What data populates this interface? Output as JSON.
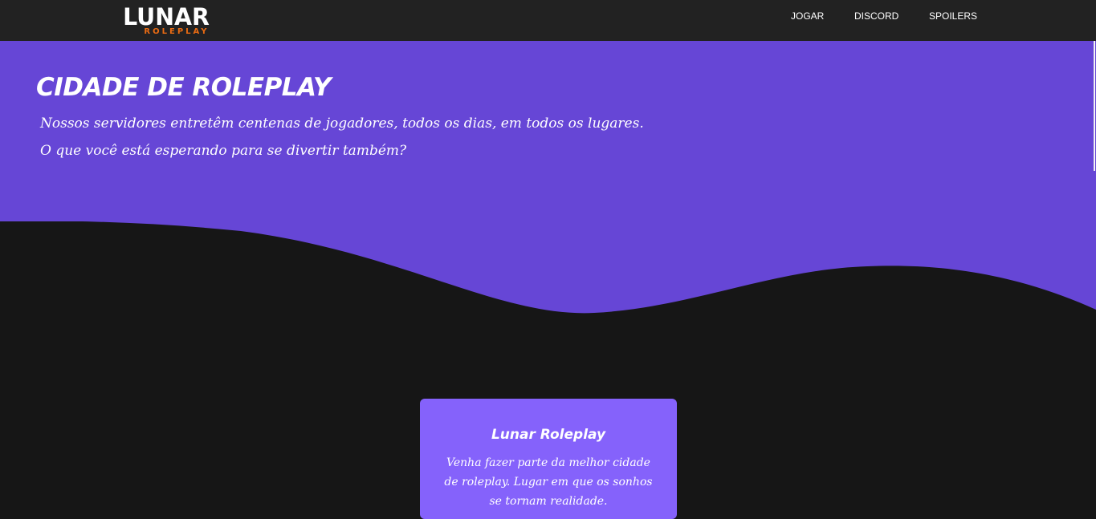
{
  "brand": {
    "name": "LUNAR",
    "tagline": "ROLEPLAY"
  },
  "nav": {
    "items": [
      {
        "label": "JOGAR"
      },
      {
        "label": "DISCORD"
      },
      {
        "label": "SPOILERS"
      }
    ]
  },
  "hero": {
    "title": "CIDADE DE ROLEPLAY",
    "line1": "Nossos servidores entretêm centenas de jogadores, todos os dias, em todos os lugares.",
    "line2": "O que você está esperando para se divertir também?"
  },
  "card": {
    "title": "Lunar Roleplay",
    "text": "Venha fazer parte da melhor cidade de roleplay. Lugar em que os sonhos se tornam realidade."
  },
  "colors": {
    "navbar": "#222222",
    "hero": "#6646d6",
    "page_background": "#161616",
    "card": "#8562fb",
    "brand_accent": "#e96b13"
  }
}
